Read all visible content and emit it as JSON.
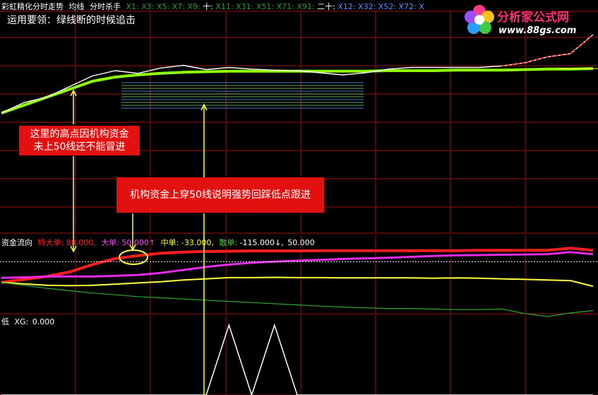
{
  "header": {
    "title": "彩虹精化分时走势",
    "avg_label": "均线",
    "indicator_name": "分时杀手",
    "ma_labels": [
      "X1: X3: X5: X7: X9:",
      "十:",
      "X11: X31: X51: X71: X91:",
      "二十:",
      "X12: X32: X52: X72:",
      "X"
    ]
  },
  "subtitle": "运用要领：绿线断的时候追击",
  "logo": {
    "title": "分析家公式网",
    "url": "www.88gs.com"
  },
  "annotations": {
    "note1": "这里的高点因机构资金\n未上50线还不能冒进",
    "note2": "机构资金上穿50线说明强势回踩低点跟进"
  },
  "fund_flow": {
    "title": "资金流向",
    "items": [
      {
        "label": "特大单:",
        "value": "88.000,"
      },
      {
        "label": "大单:",
        "value": "50.000↑"
      },
      {
        "label": "中单:",
        "value": "-33.000,"
      },
      {
        "label": "散单:",
        "value": "-115.000↓,"
      },
      {
        "label": "",
        "value": "50.000"
      }
    ]
  },
  "bottom_panel": {
    "name": "低",
    "label": "XG:",
    "value": "0.000"
  },
  "colors": {
    "grid": "#9b1010",
    "super_large": "#ff1f1f",
    "large": "#e52ce5",
    "medium": "#ffff40",
    "small": "#2ea82e",
    "ma50": "#7fff00",
    "price": "#ffffff"
  },
  "chart_data": [
    {
      "type": "line",
      "panel": "price",
      "series": [
        {
          "name": "price",
          "values": [
            0,
            2,
            3,
            5,
            7,
            8,
            7.5,
            8.5,
            9,
            8.2,
            8.6,
            8.3,
            8.1,
            8.0,
            7.6,
            7.2,
            7.6,
            8.3,
            8.6,
            8.6,
            8.6,
            8.6,
            8.9,
            9.5,
            10.6,
            11.2,
            14.8
          ]
        },
        {
          "name": "ma",
          "values": [
            0,
            1.5,
            3,
            4.5,
            6,
            6.8,
            7.2,
            7.5,
            7.7,
            7.8,
            7.9,
            7.9,
            7.9,
            7.9,
            7.9,
            7.9,
            7.9,
            8.0,
            8.0,
            8.0,
            8.1,
            8.1,
            8.1,
            8.2,
            8.3,
            8.3,
            8.4
          ]
        }
      ]
    },
    {
      "type": "line",
      "panel": "fund_flow",
      "series": [
        {
          "name": "特大单",
          "values": [
            -20,
            -10,
            0,
            15,
            40,
            60,
            70,
            78,
            82,
            84,
            85,
            86,
            86,
            86,
            87,
            87,
            87,
            87,
            87,
            87,
            87,
            88,
            88,
            88,
            88,
            95,
            88
          ]
        },
        {
          "name": "大单",
          "values": [
            -5,
            -3,
            0,
            0,
            0,
            2,
            5,
            12,
            22,
            32,
            40,
            46,
            50,
            53,
            56,
            59,
            61,
            63,
            66,
            69,
            71,
            72,
            73,
            74,
            75,
            82,
            75
          ]
        },
        {
          "name": "中单",
          "values": [
            -20,
            -25,
            -30,
            -31,
            -30,
            -26,
            -22,
            -18,
            -12,
            -8,
            -4,
            -4,
            -3,
            -4,
            -4,
            -5,
            -5,
            -5,
            -5,
            -6,
            -5,
            -6,
            -8,
            -10,
            -12,
            -14,
            -33
          ]
        },
        {
          "name": "散单",
          "values": [
            -20,
            -30,
            -40,
            -48,
            -56,
            -62,
            -68,
            -72,
            -76,
            -80,
            -84,
            -88,
            -92,
            -96,
            -100,
            -103,
            -106,
            -108,
            -108,
            -110,
            -112,
            -112,
            -110,
            -125,
            -135,
            -123,
            -115
          ]
        }
      ],
      "reference_line": 50
    },
    {
      "type": "line",
      "panel": "xg",
      "series": [
        {
          "name": "XG",
          "values": [
            0,
            0,
            0,
            0,
            0,
            0,
            0,
            0,
            0,
            0,
            1,
            0,
            1,
            0,
            0,
            0,
            0,
            0,
            0,
            0,
            0,
            0,
            0,
            0,
            0,
            0,
            0
          ]
        }
      ]
    }
  ]
}
